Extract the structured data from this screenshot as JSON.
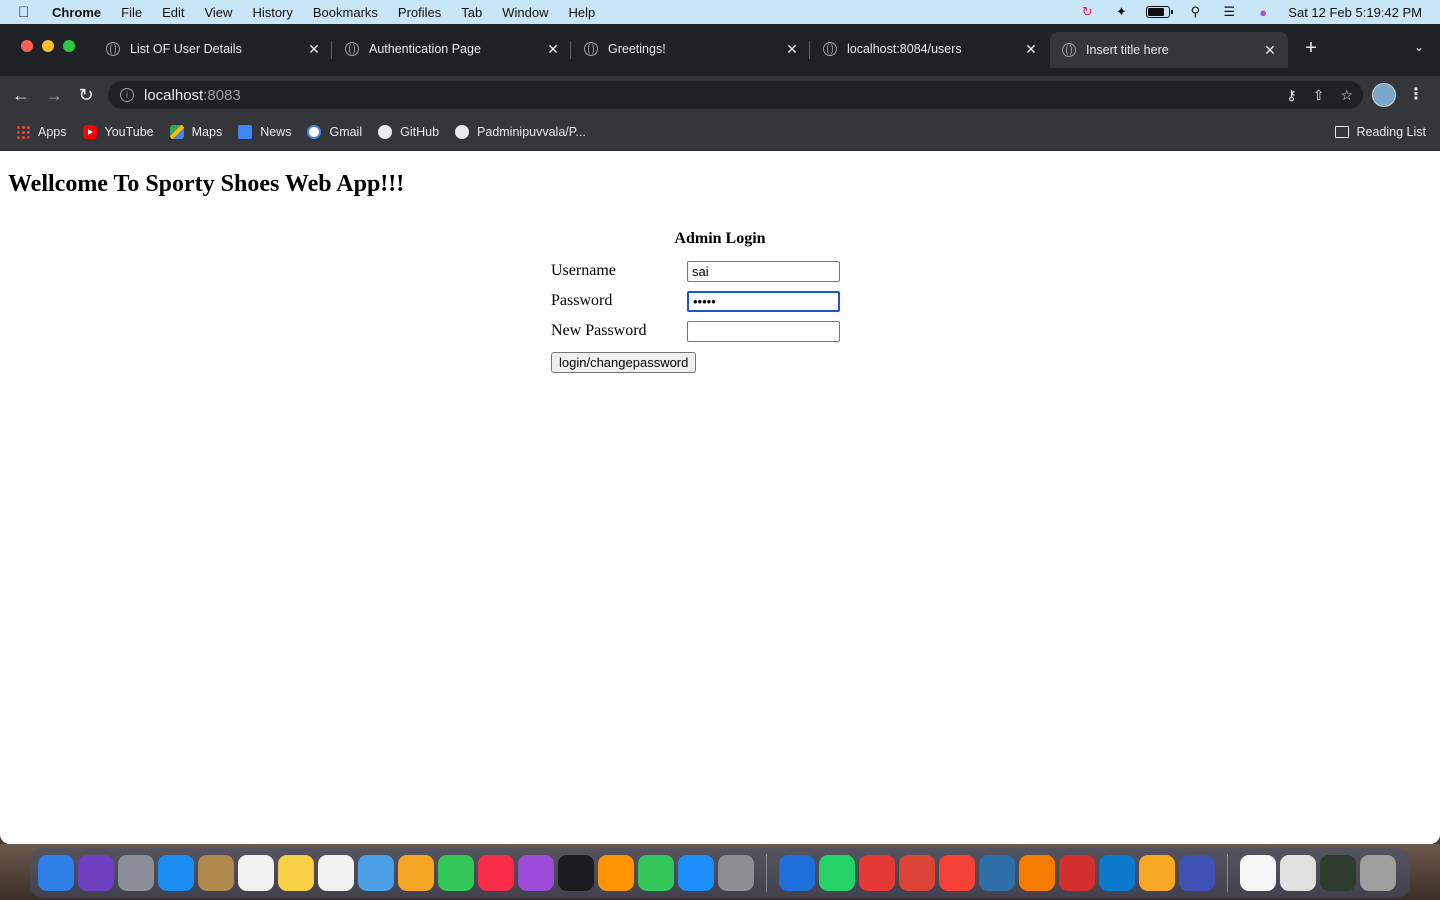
{
  "menubar": {
    "app": "Chrome",
    "items": [
      "File",
      "Edit",
      "View",
      "History",
      "Bookmarks",
      "Profiles",
      "Tab",
      "Window",
      "Help"
    ],
    "datetime": "Sat 12 Feb  5:19:42 PM"
  },
  "tabs": [
    {
      "label": "List OF User Details"
    },
    {
      "label": "Authentication Page"
    },
    {
      "label": "Greetings!"
    },
    {
      "label": "localhost:8084/users"
    },
    {
      "label": "Insert title here"
    }
  ],
  "omnibox": {
    "host": "localhost",
    "port": ":8083"
  },
  "bookmarks": [
    {
      "label": "Apps"
    },
    {
      "label": "YouTube"
    },
    {
      "label": "Maps"
    },
    {
      "label": "News"
    },
    {
      "label": "Gmail"
    },
    {
      "label": "GitHub"
    },
    {
      "label": "Padminipuvvala/P..."
    }
  ],
  "reading_list": "Reading List",
  "page": {
    "heading": "Wellcome To Sporty Shoes Web App!!!",
    "form_title": "Admin Login",
    "username_label": "Username",
    "username_value": "sai",
    "password_label": "Password",
    "password_value": "•••••",
    "new_password_label": "New Password",
    "new_password_value": "",
    "submit_label": "login/changepassword"
  },
  "dock_colors": [
    "#2d7ee6",
    "#6e3fbf",
    "#8a8f99",
    "#1b8ef2",
    "#b0894e",
    "#f2f2f2",
    "#f7d046",
    "#f2f2f2",
    "#4ca0e8",
    "#f5a623",
    "#34c759",
    "#fa2d48",
    "#9b4bd8",
    "#1c1c1e",
    "#ff9500",
    "#34c759",
    "#1c8ef9",
    "#8e8e93",
    "#1e6fd9",
    "#25d366",
    "#e53935",
    "#db4437",
    "#f44336",
    "#2f6fa7",
    "#f57c00",
    "#d32f2f",
    "#0a7acc",
    "#f9a825",
    "#3f51b5",
    "#f5f5f5",
    "#e0e0e0",
    "#2e3b2f",
    "#9e9e9e"
  ]
}
